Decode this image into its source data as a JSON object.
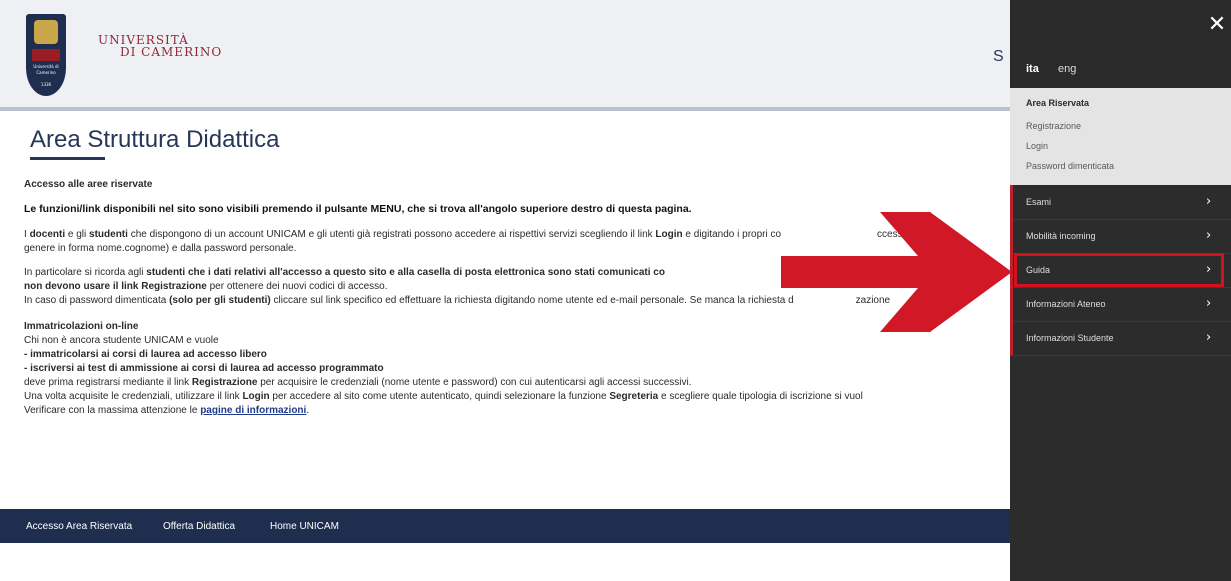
{
  "header": {
    "logo": {
      "shield_text": "UNICAM",
      "shield_subtext": "Università di Camerino",
      "year": "1336",
      "wordmark_line1": "UNIVERSITÀ",
      "wordmark_line2": "DI CAMERINO"
    },
    "partial_text": "S"
  },
  "main": {
    "title": "Area Struttura Didattica",
    "heading_access": "Accesso alle aree riservate",
    "intro_bold": "Le funzioni/link disponibili nel sito sono visibili premendo il pulsante MENU, che si trova all'angolo superiore destro di questa pagina.",
    "p1_line1_a": "I ",
    "p1_docenti": "docenti",
    "p1_line1_b": " e gli ",
    "p1_studenti": "studenti",
    "p1_line1_c": " che dispongono di un account UNICAM e gli utenti già registrati possono accedere ai rispettivi servizi scegliendo il link ",
    "p1_login": "Login",
    "p1_line1_d": " e digitando i propri co",
    "p1_line1_e": "ccesso, cos",
    "p1_line2": "genere in forma nome.cognome) e dalla password personale.",
    "p2_line1_a": "In particolare si ricorda agli ",
    "p2_line1_b": "studenti che i dati relativi all'accesso a questo sito e alla casella di posta elettronica sono stati comunicati co",
    "p2_line1_c": "di",
    "p2_line2_a": "non devono usare il link Registrazione",
    "p2_line2_b": " per ottenere dei nuovi codici di accesso.",
    "p2_line3_a": "In caso di password dimenticata ",
    "p2_line3_b": "(solo per gli studenti)",
    "p2_line3_c": " cliccare sul link specifico ed effettuare la richiesta digitando nome utente ed e-mail personale. Se manca la richiesta d",
    "p2_line3_d": "zazione",
    "heading_immat": "Immatricolazioni on-line",
    "p3_line1": "Chi non è ancora studente UNICAM e vuole",
    "p3_line2": "- immatricolarsi ai corsi di laurea ad accesso libero",
    "p3_line3": "- iscriversi ai test di ammissione ai corsi di laurea ad accesso programmato",
    "p3_line4_a": "deve prima registrarsi mediante il link ",
    "p3_line4_b": "Registrazione",
    "p3_line4_c": " per acquisire le credenziali (nome utente e password) con cui autenticarsi agli accessi successivi.",
    "p3_line5_a": "Una volta acquisite le credenziali, utilizzare il link ",
    "p3_line5_b": "Login",
    "p3_line5_c": " per accedere al sito come utente autenticato, quindi selezionare la funzione ",
    "p3_line5_d": "Segreteria",
    "p3_line5_e": " e scegliere quale tipologia di iscrizione si vuol",
    "p3_line6_a": "Verificare con la massima attenzione le ",
    "p3_line6_link": "pagine di informazioni",
    "p3_line6_b": "."
  },
  "footer": {
    "links": [
      "Accesso Area Riservata",
      "Offerta Didattica",
      "Home UNICAM"
    ]
  },
  "sidebar": {
    "close_icon": "close-icon",
    "lang_active": "ita",
    "lang_other": "eng",
    "area_title": "Area Riservata",
    "area_links": [
      "Registrazione",
      "Login",
      "Password dimenticata"
    ],
    "items": [
      {
        "label": "Esami"
      },
      {
        "label": "Mobilità incoming"
      },
      {
        "label": "Guida"
      },
      {
        "label": "Informazioni Ateneo"
      },
      {
        "label": "Informazioni Studente"
      }
    ],
    "chevron": "›"
  },
  "colors": {
    "brand_navy": "#1f2e4e",
    "title_color": "#283758",
    "sidebar_bg": "#2c2c2c",
    "highlight_red": "#d4121f",
    "arrow_red": "#d01826"
  }
}
